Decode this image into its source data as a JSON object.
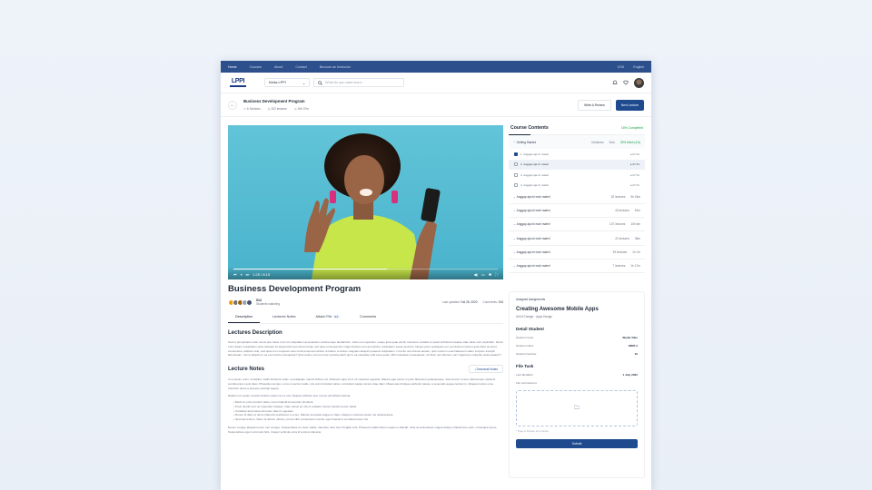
{
  "topbar": {
    "nav": [
      "Home",
      "Courses",
      "About",
      "Contact",
      "Become an Instructor"
    ],
    "currency": "USD",
    "language": "English"
  },
  "header": {
    "logo_text": "LPPI",
    "category": "Kelas LPPI",
    "search_placeholder": "What do you want learn..."
  },
  "course": {
    "title": "Business Development Program",
    "sections": "6 Sections",
    "lectures": "202 lectures",
    "duration": "19h 37m",
    "write_review": "Write A Review",
    "next_lecture": "Next Lecture"
  },
  "player": {
    "time": "1:25 / 8:15",
    "progress": 0.58
  },
  "info": {
    "title": "Business Development Program",
    "students_count": "512",
    "students_label": "Students watching",
    "last_updated_label": "Last updated:",
    "last_updated": "Oct 26, 2020",
    "comments_label": "Comments:",
    "comments": "154"
  },
  "tabs": [
    {
      "label": "Description"
    },
    {
      "label": "Lectures Notes"
    },
    {
      "label": "Attach File",
      "badge": "01"
    },
    {
      "label": "Comments"
    }
  ],
  "description": {
    "title": "Lectures Description",
    "text": "Sed ut perspiciatis unde omnis iste natus error sit voluptatem accusantium doloremque laudantium, totam rem aperiam, eaque ipsa quae ab illo inventore veritatis et quasi architecto beatae vitae dicta sunt explicabo. Nemo enim ipsam voluptatem quia voluptas sit aspernatur aut odit aut fugit, sed quia consequuntur magni dolores eos qui ratione voluptatem sequi nesciunt. Neque porro quisquam est, qui dolorem ipsum quia dolor sit amet, consectetur, adipisci velit, sed quia non numquam eius modi tempora incidunt ut labore et dolore magnam aliquam quaerat voluptatem. Ut enim ad minima veniam, quis nostrum exercitationem ullam corporis suscipit laboriosam, nisi ut aliquid ex ea commodi consequatur? Quis autem vel eum iure reprehenderit qui in ea voluptate velit esse quam nihil molestiae consequatur, vel illum qui dolorem eum fugiat quo voluptas nulla pariatur?"
  },
  "notes": {
    "title": "Lecture Notes",
    "download": "Download Notes",
    "p1": "In ut ipsum enim. Curabitur mollis tincidunt turpis, sed aliquam mauris finibus vel. Praesent eget mi in mi maximus egestas. Mauris eget ipsum in justo bibendum pellentesque. Sed id arcu in arcu ullamcorper eleifend condimentum quis diam. Phasellus tempus, urna ut auctor mattis, nisi enim tincidunt tellus, a tincidunt sapien lectus vitae diam. Maecenas tristique eleifend massa, a venenatis augue tempor in. Aliquam luctus urna. Interdum lacus a posuere suscipit augue.",
    "p2": "Nullam non quam a lectus finibus varius nec a orci. Aliquam efficitur sem cursus elit efficitur lacinia.",
    "bullets": [
      "Morbi et enim pretium tellus, lorem blandit fermentum tincidunt.",
      "Proin iaculis sem ac imperdiet tristique. Nam varius ac nisi et sodales. Donec iaculis metus mattis.",
      "Curabitur accumsan elit lorem diam in egestas.",
      "Donec id diam et lacus pharetra vestibulum in a leo. Mauris venenatis augue ut diam. Aliquam maximus quam vel pellentesque.",
      "Sed elementum, libero id dictum ultrices, purus nibh consectetur mauris, eget interdum vel ullamcorper nisi."
    ],
    "p3": "Donec congue aliquam lorem nec congue. Suspendisse eu risus mattis, interdum ante sed, fringilla urna. Praesent mattis dictum sapien a blandit. Cras at scelerisque magna aliquet, blandit arcu quis, consequat purus. Suspendisse eget commodo felis. Integer vehicula urna id tempus placerat."
  },
  "contents": {
    "title": "Course Contents",
    "completed": "15% Completed",
    "open_section": {
      "name": "Getting Started",
      "lectures": "4 lectures",
      "duration": "51m",
      "finished": "25% finish (1/4)",
      "items": [
        {
          "label": "1. anggap aja ini materi",
          "time": "07:31",
          "checked": true,
          "selected": false
        },
        {
          "label": "2. anggap aja ini materi",
          "time": "07:31",
          "checked": false,
          "selected": true
        },
        {
          "label": "3. anggap aja ini materi",
          "time": "07:31",
          "checked": false,
          "selected": false
        },
        {
          "label": "4. anggap aja ini materi",
          "time": "07:31",
          "checked": false,
          "selected": false
        }
      ]
    },
    "sections": [
      {
        "name": "Anggap aja ini mah materi",
        "lectures": "52 lectures",
        "duration": "5h 49m"
      },
      {
        "name": "Anggap aja ini mah materi",
        "lectures": "43 lectures",
        "duration": "51m"
      },
      {
        "name": "Anggap aja ini mah materi",
        "lectures": "137 lectures",
        "duration": "10h 6m"
      },
      {
        "name": "Anggap aja ini mah materi",
        "lectures": "21 lectures",
        "duration": "38m"
      },
      {
        "name": "Anggap aja ini mah materi",
        "lectures": "39 lectures",
        "duration": "1h 7m"
      },
      {
        "name": "Anggap aja ini mah materi",
        "lectures": "7 lectures",
        "duration": "1h 17m"
      }
    ]
  },
  "assignment": {
    "label": "Assigned Assignments",
    "title": "Creating Awesome Mobile Apps",
    "subtitle": "UI/UX Design · Apps Design",
    "detail_title": "Detail Student",
    "student_name_label": "Student name",
    "student_name": "Skylar Dias",
    "student_class_label": "Student Class",
    "student_class": "MIPA 2",
    "student_number_label": "Student Number",
    "student_number": "10",
    "file_task_title": "File Task",
    "last_modified_label": "Last Modified",
    "last_modified": "1 July 2022",
    "file_submissions_label": "File submissions",
    "upload_hint": "* Drag or browse from device",
    "submit": "Submit"
  },
  "colors": {
    "topbar": "#2d4f8c",
    "primary": "#1f4b8e",
    "success": "#16a34a",
    "video_bg": "#55bcd2"
  }
}
